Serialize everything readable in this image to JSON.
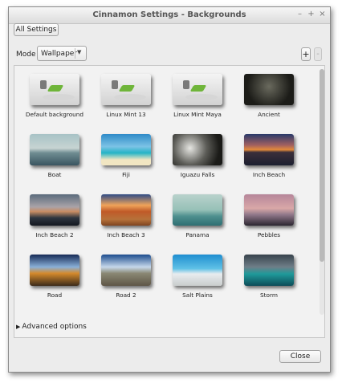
{
  "window": {
    "title": "Cinnamon Settings - Backgrounds",
    "controls": {
      "minimize": "–",
      "maximize": "+",
      "close": "×"
    }
  },
  "toolbar": {
    "all_settings": "All Settings",
    "mode_label": "Mode",
    "mode_value": "Wallpaper",
    "add": "+",
    "remove": "-"
  },
  "wallpapers": [
    {
      "name": "Default background",
      "icon": "default"
    },
    {
      "name": "Linux Mint 13",
      "icon": "lm13"
    },
    {
      "name": "Linux Mint Maya",
      "icon": "lmmaya"
    },
    {
      "name": "Ancient",
      "icon": "ancient"
    },
    {
      "name": "Boat",
      "icon": "boat"
    },
    {
      "name": "Fiji",
      "icon": "fiji"
    },
    {
      "name": "Iguazu Falls",
      "icon": "iguazu"
    },
    {
      "name": "Inch Beach",
      "icon": "inch"
    },
    {
      "name": "Inch Beach 2",
      "icon": "inch2"
    },
    {
      "name": "Inch Beach 3",
      "icon": "inch3"
    },
    {
      "name": "Panama",
      "icon": "panama"
    },
    {
      "name": "Pebbles",
      "icon": "pebbles"
    },
    {
      "name": "Road",
      "icon": "road"
    },
    {
      "name": "Road 2",
      "icon": "road2"
    },
    {
      "name": "Salt Plains",
      "icon": "salt"
    },
    {
      "name": "Storm",
      "icon": "storm"
    }
  ],
  "advanced_options": "Advanced options",
  "close_button": "Close"
}
